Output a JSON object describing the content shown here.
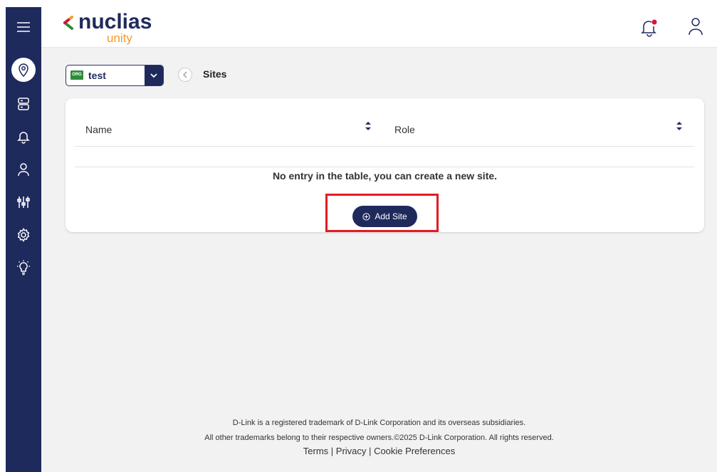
{
  "brand": {
    "name": "nuclias",
    "sub": "unity"
  },
  "org": {
    "badge": "ORG",
    "name": "test"
  },
  "page": {
    "title": "Sites"
  },
  "table": {
    "columns": [
      "Name",
      "Role"
    ],
    "empty_message": "No entry in the table, you can create a new site."
  },
  "actions": {
    "add_site_label": "Add Site"
  },
  "footer": {
    "line1": "D-Link is a registered trademark of D-Link Corporation and its overseas subsidiaries.",
    "line2": "All other trademarks belong to their respective owners.©2025 D-Link Corporation. All rights reserved.",
    "links": [
      "Terms",
      "Privacy",
      "Cookie Preferences"
    ],
    "separator": "|"
  },
  "sidebar": {
    "items": [
      "menu-icon",
      "location-icon",
      "devices-icon",
      "alerts-icon",
      "user-icon",
      "settings-sliders-icon",
      "gear-icon",
      "lightbulb-icon"
    ]
  },
  "colors": {
    "navy": "#1f2a5c",
    "accent_orange": "#f39a2b",
    "highlight_red": "#e31b23",
    "org_green": "#2e8b3a",
    "notification_red": "#d6163a"
  }
}
